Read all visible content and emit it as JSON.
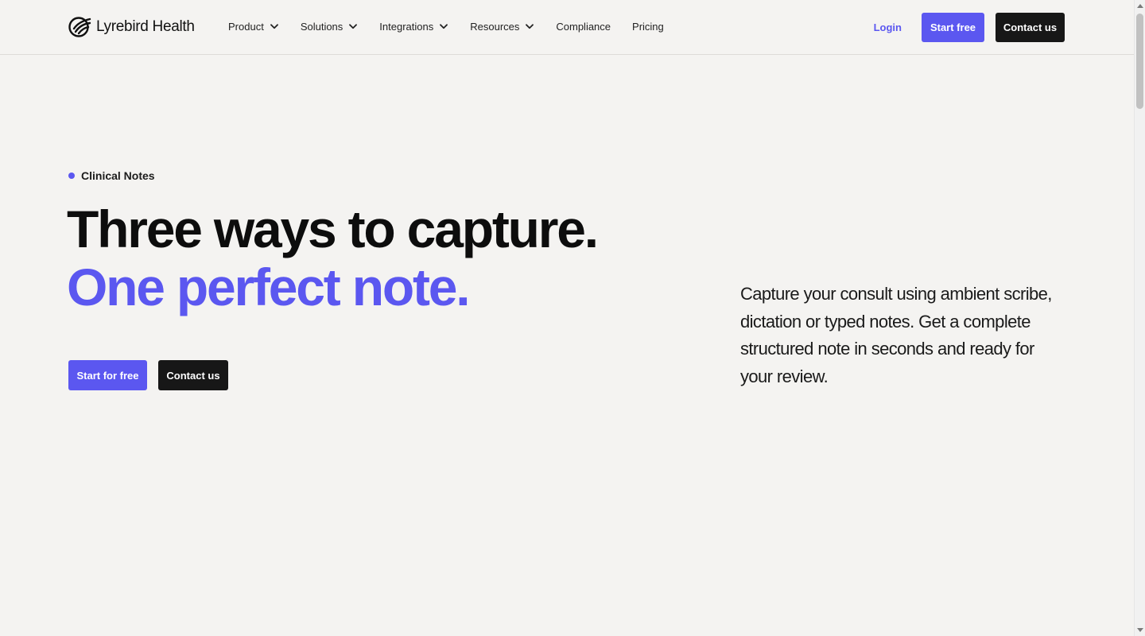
{
  "brand": {
    "name": "Lyrebird Health",
    "logo_icon": "lyrebird-swirl-icon",
    "accent_color": "#5b57f0",
    "dark_color": "#171717",
    "background_color": "#f4f3f1"
  },
  "nav": {
    "items": [
      {
        "label": "Product",
        "has_dropdown": true,
        "icon": "chevron-down-icon"
      },
      {
        "label": "Solutions",
        "has_dropdown": true,
        "icon": "chevron-down-icon"
      },
      {
        "label": "Integrations",
        "has_dropdown": true,
        "icon": "chevron-down-icon"
      },
      {
        "label": "Resources",
        "has_dropdown": true,
        "icon": "chevron-down-icon"
      },
      {
        "label": "Compliance",
        "has_dropdown": false
      },
      {
        "label": "Pricing",
        "has_dropdown": false
      }
    ]
  },
  "header_actions": {
    "login_label": "Login",
    "start_label": "Start free",
    "contact_label": "Contact us"
  },
  "hero": {
    "eyebrow": "Clinical Notes",
    "headline_line1": "Three ways to capture.",
    "headline_line2": "One perfect note.",
    "start_label": "Start for free",
    "contact_label": "Contact us",
    "description": "Capture your consult using ambient scribe, dictation or typed notes. Get a complete structured note in seconds and ready for your review."
  }
}
